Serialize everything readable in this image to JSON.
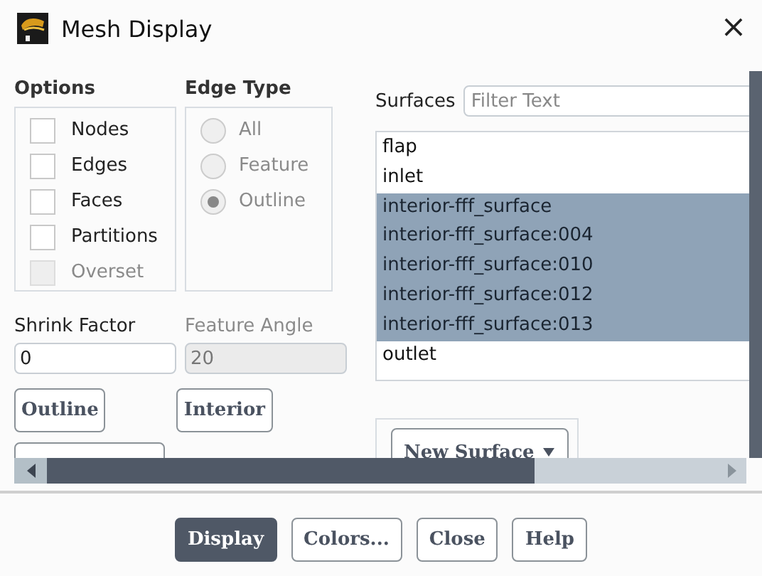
{
  "window": {
    "title": "Mesh Display",
    "close": "×"
  },
  "options": {
    "label": "Options",
    "items": [
      {
        "label": "Nodes",
        "checked": false,
        "disabled": false
      },
      {
        "label": "Edges",
        "checked": false,
        "disabled": false
      },
      {
        "label": "Faces",
        "checked": false,
        "disabled": false
      },
      {
        "label": "Partitions",
        "checked": false,
        "disabled": false
      },
      {
        "label": "Overset",
        "checked": false,
        "disabled": true
      }
    ]
  },
  "edge_type": {
    "label": "Edge Type",
    "disabled": true,
    "items": [
      {
        "label": "All",
        "selected": false
      },
      {
        "label": "Feature",
        "selected": false
      },
      {
        "label": "Outline",
        "selected": true
      }
    ]
  },
  "fields": [
    {
      "label": "Shrink Factor",
      "value": "0",
      "disabled": false
    },
    {
      "label": "Feature Angle",
      "value": "20",
      "disabled": true
    }
  ],
  "left_buttons": [
    "Outline",
    "Interior"
  ],
  "surfaces": {
    "label": "Surfaces",
    "placeholder": "Filter Text",
    "items": [
      {
        "label": "flap",
        "selected": false
      },
      {
        "label": "inlet",
        "selected": false
      },
      {
        "label": "interior-fff_surface",
        "selected": true
      },
      {
        "label": "interior-fff_surface:004",
        "selected": true
      },
      {
        "label": "interior-fff_surface:010",
        "selected": true
      },
      {
        "label": "interior-fff_surface:012",
        "selected": true
      },
      {
        "label": "interior-fff_surface:013",
        "selected": true
      },
      {
        "label": "outlet",
        "selected": false
      }
    ]
  },
  "new_surface_button": "New Surface",
  "buttons": [
    {
      "label": "Display",
      "kind": "primary"
    },
    {
      "label": "Colors...",
      "kind": "normal"
    },
    {
      "label": "Close",
      "kind": "normal"
    },
    {
      "label": "Help",
      "kind": "normal"
    }
  ]
}
